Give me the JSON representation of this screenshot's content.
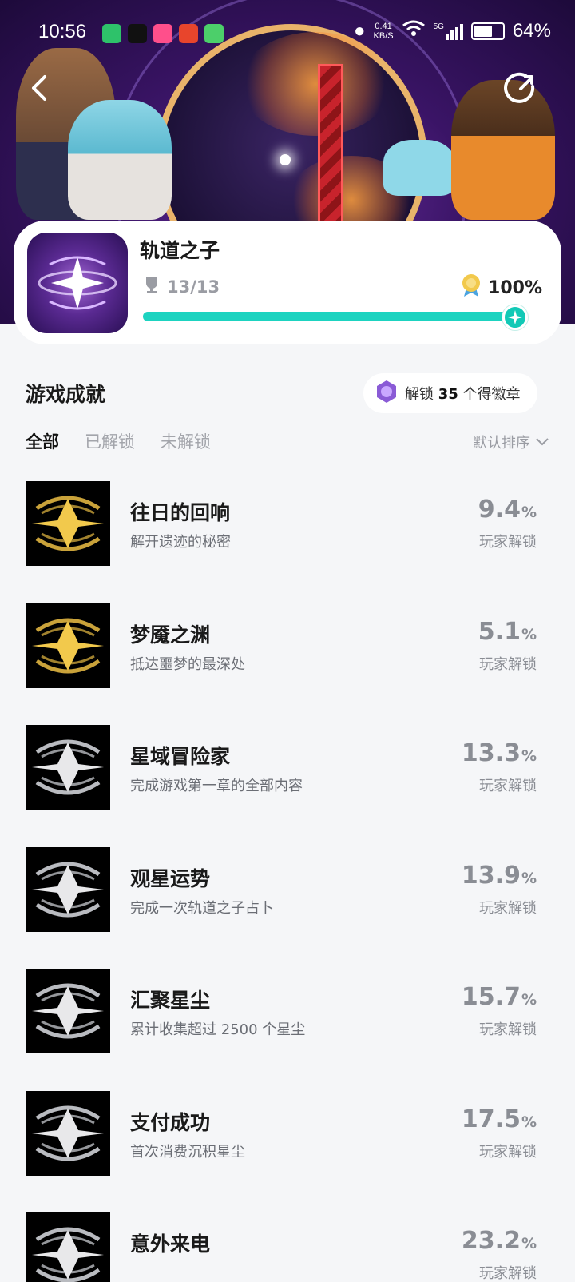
{
  "status_bar": {
    "time": "10:56",
    "net_speed": "0.41",
    "net_unit": "KB/S",
    "network": "5G",
    "battery": "64%"
  },
  "game": {
    "title": "轨道之子",
    "trophies": "13/13",
    "completion": "100%",
    "progress_fraction": 1.0
  },
  "section": {
    "title": "游戏成就",
    "badge_prefix": "解锁",
    "badge_count": "35",
    "badge_suffix": "个得徽章",
    "tabs": [
      "全部",
      "已解锁",
      "未解锁"
    ],
    "sort_label": "默认排序"
  },
  "achievements": [
    {
      "name": "往日的回响",
      "desc": "解开遗迹的秘密",
      "pct": "9.4",
      "unit": "%",
      "label": "玩家解锁",
      "tier": "gold"
    },
    {
      "name": "梦魇之渊",
      "desc": "抵达噩梦的最深处",
      "pct": "5.1",
      "unit": "%",
      "label": "玩家解锁",
      "tier": "gold"
    },
    {
      "name": "星域冒险家",
      "desc": "完成游戏第一章的全部内容",
      "pct": "13.3",
      "unit": "%",
      "label": "玩家解锁",
      "tier": "silver"
    },
    {
      "name": "观星运势",
      "desc": "完成一次轨道之子占卜",
      "pct": "13.9",
      "unit": "%",
      "label": "玩家解锁",
      "tier": "silver"
    },
    {
      "name": "汇聚星尘",
      "desc": "累计收集超过 2500 个星尘",
      "pct": "15.7",
      "unit": "%",
      "label": "玩家解锁",
      "tier": "silver"
    },
    {
      "name": "支付成功",
      "desc": "首次消费沉积星尘",
      "pct": "17.5",
      "unit": "%",
      "label": "玩家解锁",
      "tier": "silver"
    },
    {
      "name": "意外来电",
      "desc": "",
      "pct": "23.2",
      "unit": "%",
      "label": "玩家解锁",
      "tier": "silver"
    }
  ],
  "colors": {
    "accent": "#1dd3c0",
    "gold": "#f2c94c",
    "silver": "#e8e8ea"
  }
}
